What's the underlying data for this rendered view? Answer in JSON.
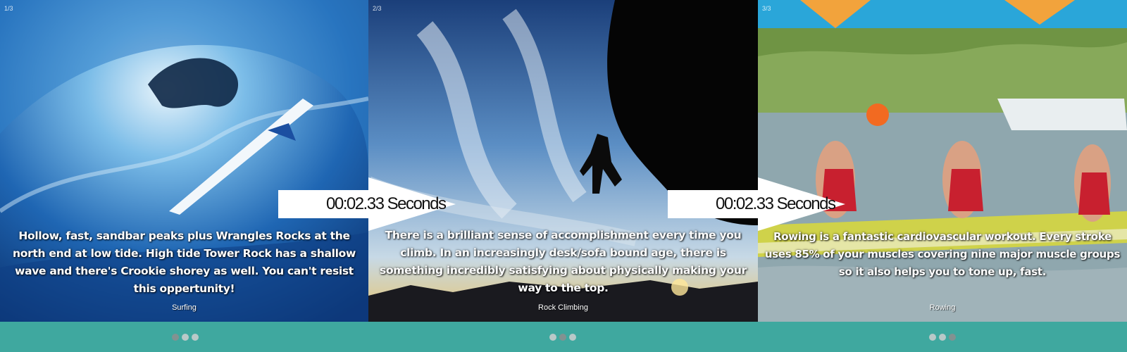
{
  "slides": [
    {
      "counter": "1/3",
      "caption": "Hollow, fast, sandbar peaks plus Wrangles Rocks at the north end at low tide. High tide Tower Rock has a shallow wave and there's Crookie shorey as well. You can't resist this oppertunity!",
      "title": "Surfing",
      "active_dot": 1
    },
    {
      "counter": "2/3",
      "caption": "There is a brilliant sense of accomplishment every time you climb. In an increasingly desk/sofa bound age, there is something incredibly satisfying about physically making your way to the top.",
      "title": "Rock Climbing",
      "active_dot": 2
    },
    {
      "counter": "3/3",
      "caption": "Rowing is a fantastic cardiovascular workout. Every stroke uses 85% of your muscles covering nine major muscle groups so it also helps you to tone up, fast.",
      "title": "Rowing",
      "active_dot": 3
    }
  ],
  "timers": [
    {
      "label": "00:02.33 Seconds"
    },
    {
      "label": "00:02.33 Seconds"
    }
  ],
  "colors": {
    "footer": "#3fa89f",
    "dot_inactive": "#cfcfcf",
    "dot_active": "#8e8e8e"
  }
}
